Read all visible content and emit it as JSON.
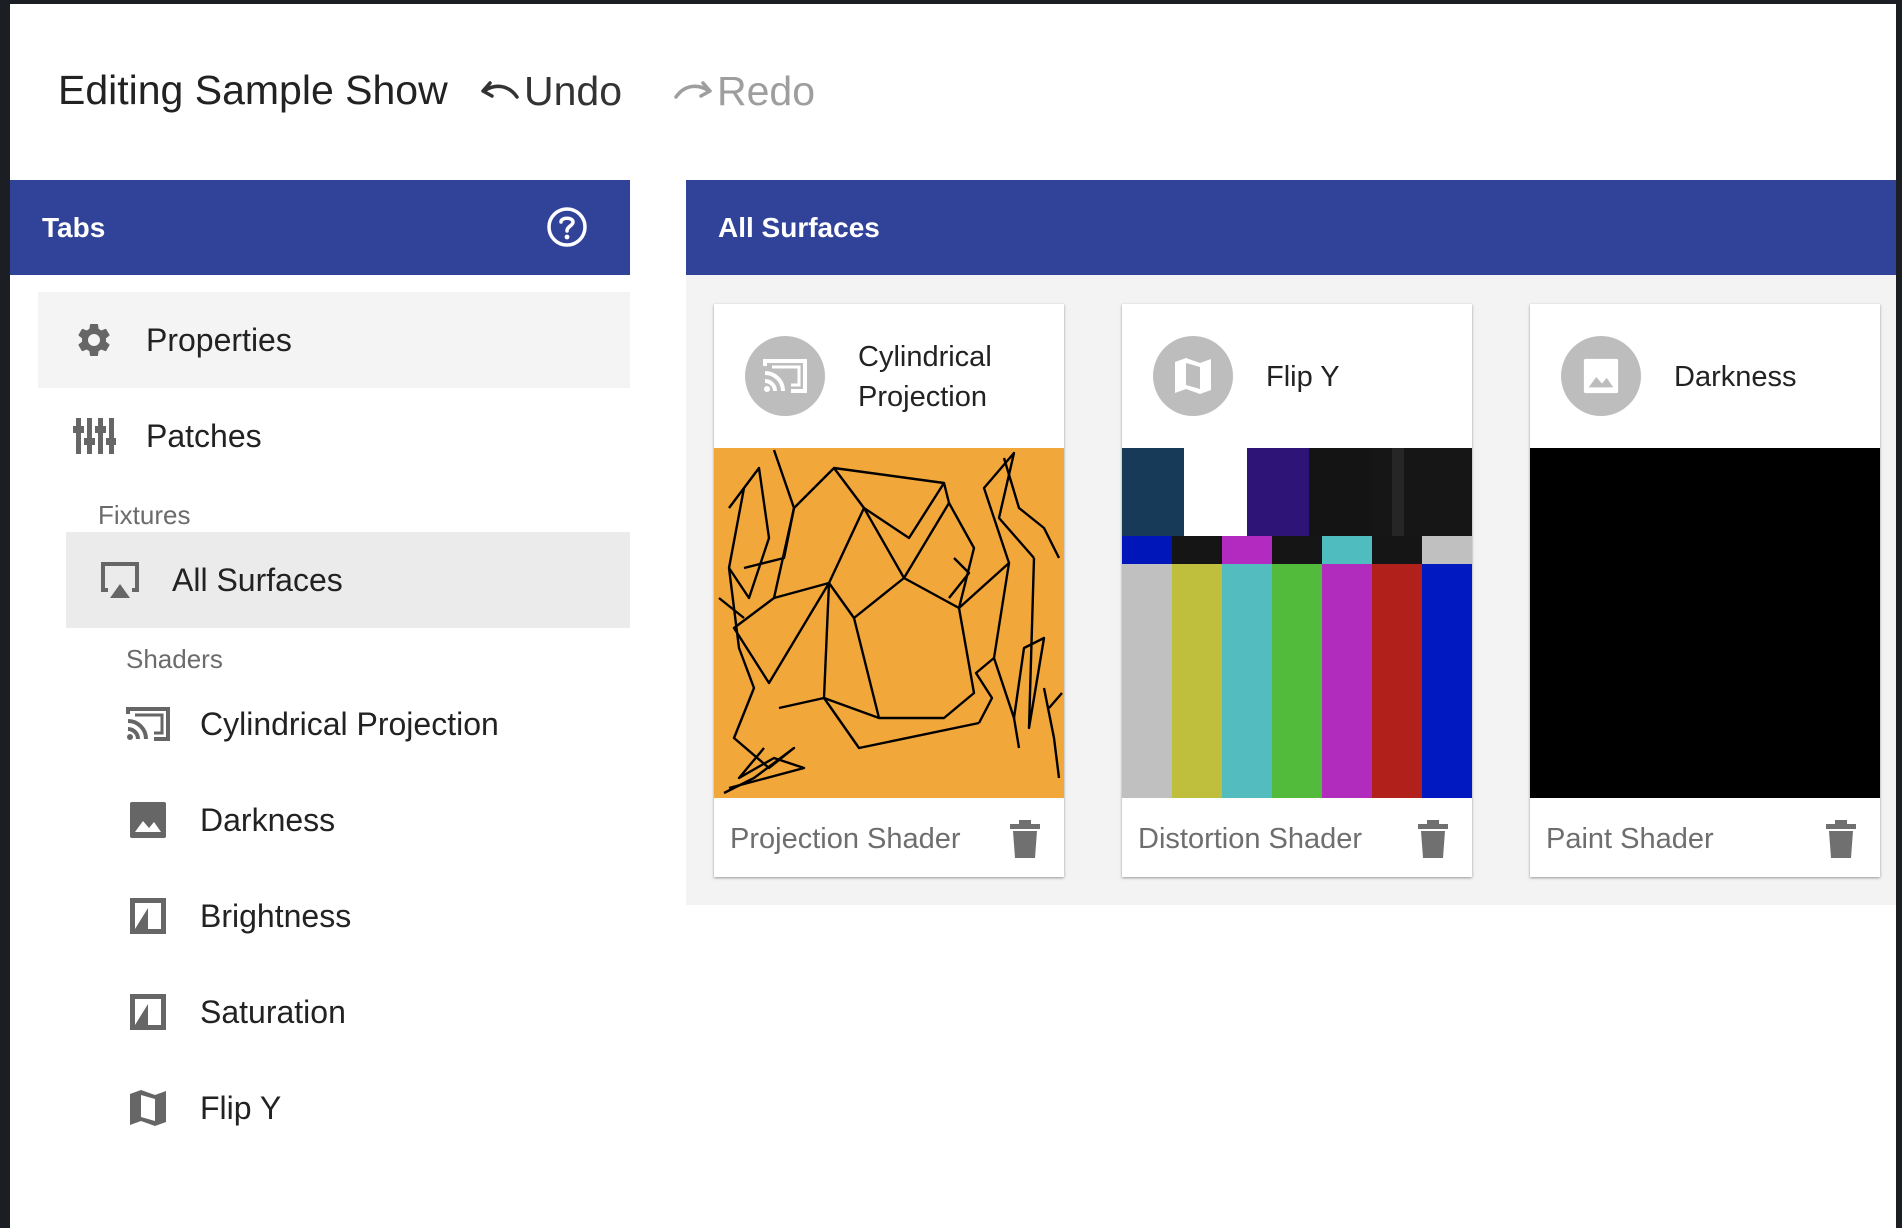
{
  "header": {
    "title": "Editing Sample Show",
    "undo_label": "Undo",
    "redo_label": "Redo"
  },
  "tabs_panel": {
    "title": "Tabs",
    "help_icon": "help-circle-icon",
    "items": [
      {
        "label": "Properties",
        "icon": "gear-icon",
        "selected": true
      },
      {
        "label": "Patches",
        "icon": "sliders-icon",
        "selected": false
      }
    ],
    "fixtures_label": "Fixtures",
    "fixtures_items": [
      {
        "label": "All Surfaces",
        "icon": "airplay-icon",
        "selected": true
      }
    ],
    "shaders_label": "Shaders",
    "shaders_items": [
      {
        "label": "Cylindrical Projection",
        "icon": "cast-icon"
      },
      {
        "label": "Darkness",
        "icon": "image-icon"
      },
      {
        "label": "Brightness",
        "icon": "exposure-icon"
      },
      {
        "label": "Saturation",
        "icon": "exposure-icon"
      },
      {
        "label": "Flip Y",
        "icon": "map-icon"
      }
    ]
  },
  "surfaces_panel": {
    "title": "All Surfaces",
    "cards": [
      {
        "title": "Cylindrical Projection",
        "subtitle": "Projection Shader",
        "icon": "cast-icon",
        "preview": "orange-with-black-lines"
      },
      {
        "title": "Flip Y",
        "subtitle": "Distortion Shader",
        "icon": "map-icon",
        "preview": "color-bars"
      },
      {
        "title": "Darkness",
        "subtitle": "Paint Shader",
        "icon": "image-icon",
        "preview": "solid-black"
      }
    ]
  },
  "colors": {
    "header_blue": "#314398",
    "selected_bg": "#f4f4f4",
    "panel_bg": "#f3f3f3",
    "orange": "#f2a73b"
  }
}
